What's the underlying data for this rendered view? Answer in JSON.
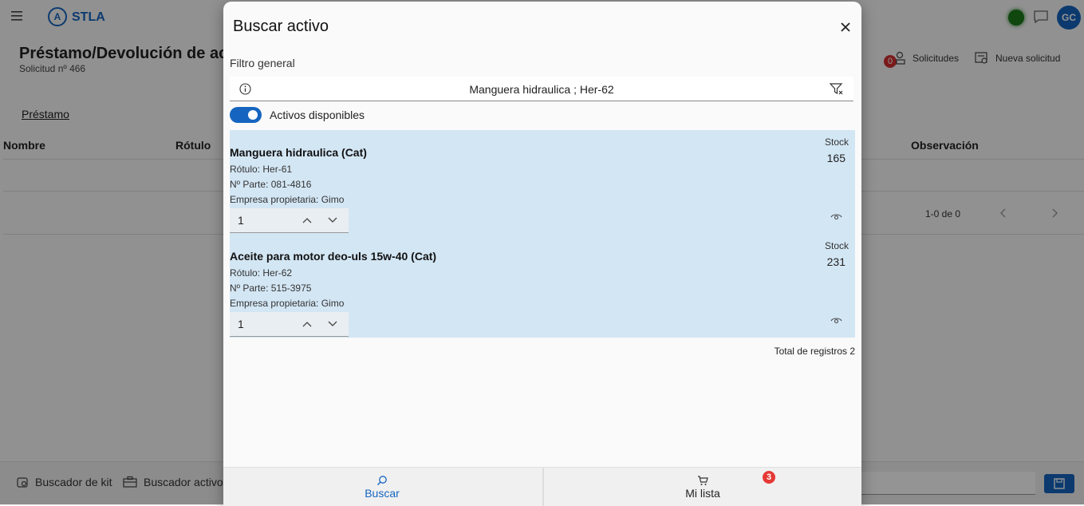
{
  "app": {
    "brand": "STLA",
    "logo_letter": "A",
    "user_initials": "GC",
    "page_title": "Préstamo/Devolución de acti",
    "page_subtitle": "Solicitud nº 466",
    "requests": {
      "badge": "0",
      "label": "Solicitudes"
    },
    "new_request": {
      "label": "Nueva solicitud"
    },
    "tab": "Préstamo",
    "columns": [
      "Nombre",
      "Rótulo",
      "Observación"
    ],
    "pager": "1-0 de 0",
    "bottom": {
      "kit_label": "Buscador de kit",
      "active_label": "Buscador activo"
    },
    "colors": {
      "accent": "#1565c0",
      "status": "#1b7a1b",
      "badge": "#d32f2f"
    }
  },
  "dialog": {
    "title": "Buscar activo",
    "filter_label": "Filtro general",
    "filter_value": "Manguera hidraulica ; Her-62",
    "toggle_label": "Activos disponibles",
    "toggle_on": true,
    "results": [
      {
        "name": "Manguera hidraulica (Cat)",
        "rotulo": "Rótulo: Her-61",
        "parte": "Nº Parte: 081-4816",
        "empresa": "Empresa propietaria: Gimo",
        "stock_label": "Stock",
        "stock": "165",
        "qty": "1"
      },
      {
        "name": "Aceite para motor deo-uls 15w-40 (Cat)",
        "rotulo": "Rótulo: Her-62",
        "parte": "Nº Parte: 515-3975",
        "empresa": "Empresa propietaria: Gimo",
        "stock_label": "Stock",
        "stock": "231",
        "qty": "1"
      }
    ],
    "total": "Total de registros 2",
    "footer": {
      "search_label": "Buscar",
      "list_label": "Mi lista",
      "cart_count": "3"
    },
    "colors": {
      "results_bg": "#d3e6f4",
      "toggle": "#1565c0",
      "cart_badge": "#e53935"
    }
  }
}
